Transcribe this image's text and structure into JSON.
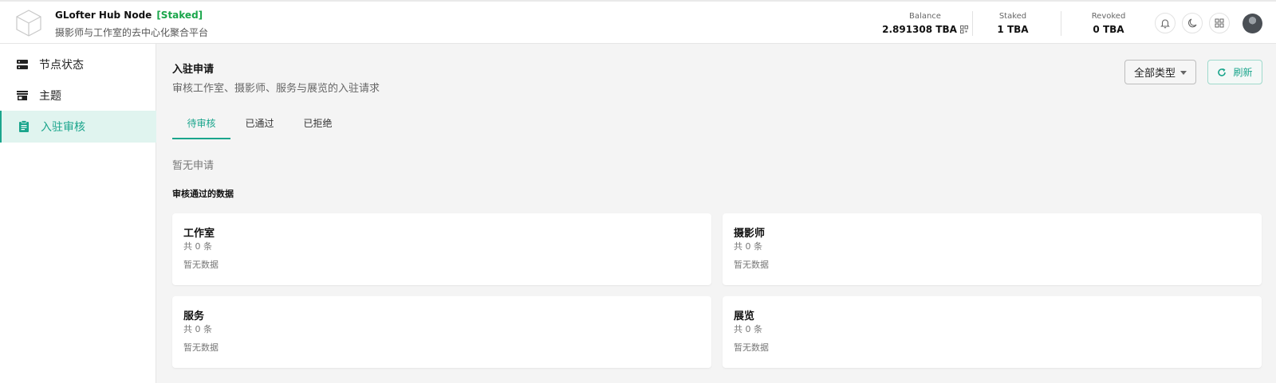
{
  "header": {
    "node_name": "GLofter Hub Node",
    "node_status": "[Staked]",
    "subtitle": "摄影师与工作室的去中心化聚合平台",
    "balance_label": "Balance",
    "balance_value": "2.891308 TBA",
    "staked_label": "Staked",
    "staked_value": "1 TBA",
    "revoked_label": "Revoked",
    "revoked_value": "0 TBA"
  },
  "sidebar": {
    "items": [
      {
        "label": "节点状态",
        "icon": "server-icon"
      },
      {
        "label": "主题",
        "icon": "store-icon"
      },
      {
        "label": "入驻审核",
        "icon": "clipboard-icon",
        "active": true
      }
    ]
  },
  "main": {
    "title": "入驻申请",
    "description": "审核工作室、摄影师、服务与展览的入驻请求",
    "type_filter": "全部类型",
    "refresh_label": "刷新",
    "tabs": [
      {
        "label": "待审核",
        "active": true
      },
      {
        "label": "已通过"
      },
      {
        "label": "已拒绝"
      }
    ],
    "empty_applications": "暂无申请",
    "approved_section_title": "审核通过的数据",
    "cards": [
      {
        "title": "工作室",
        "count": "共 0 条",
        "empty": "暂无数据"
      },
      {
        "title": "摄影师",
        "count": "共 0 条",
        "empty": "暂无数据"
      },
      {
        "title": "服务",
        "count": "共 0 条",
        "empty": "暂无数据"
      },
      {
        "title": "展览",
        "count": "共 0 条",
        "empty": "暂无数据"
      }
    ]
  },
  "colors": {
    "accent": "#1aa58c",
    "staked_green": "#1aa64b",
    "active_bg": "#e0f4ef"
  }
}
